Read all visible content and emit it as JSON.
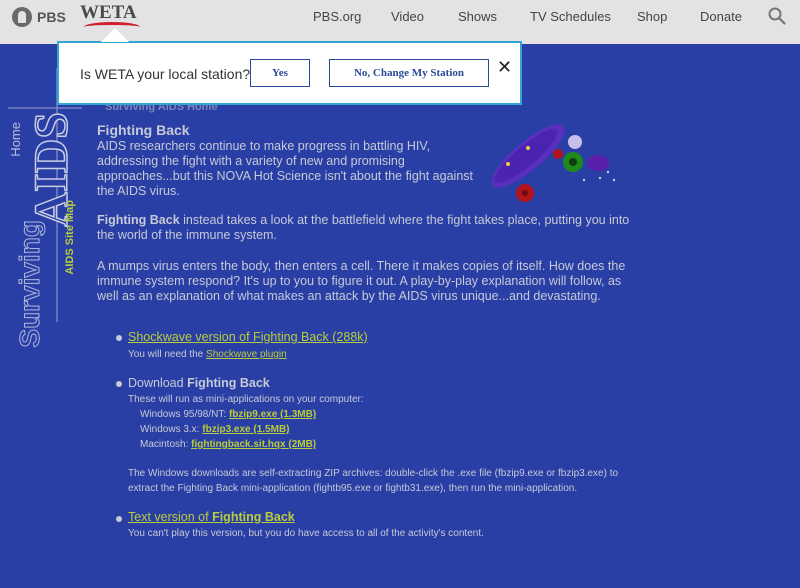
{
  "pbs_bar": {
    "pbs_logo": "PBS",
    "weta_logo": "WETA",
    "nav": [
      "PBS.org",
      "Video",
      "Shows",
      "TV Schedules",
      "Shop",
      "Donate"
    ]
  },
  "popup": {
    "question": "Is WETA your local station?",
    "yes": "Yes",
    "no": "No, Change My Station",
    "close": "✕"
  },
  "side": {
    "home": "Home",
    "aids": "AIDS",
    "surviving": "Surviving",
    "sitemap": "AIDS Site Map"
  },
  "article": {
    "hidden_heading": "Surviving AIDS Home",
    "title": "Fighting Back",
    "p1": "AIDS researchers continue to make progress in battling HIV, addressing the fight with a variety of new and promising approaches...but this NOVA Hot Science isn't about the fight against the AIDS virus.",
    "p2_bold": "Fighting Back",
    "p2_rest": " instead takes a look at the battlefield where the fight takes place, putting you into the world of the immune system.",
    "p3": "A mumps virus enters the body, then enters a cell. There it makes copies of itself. How does the immune system respond? It's up to you to figure it out. A play-by-play explanation will follow, as well as an explanation of what makes an attack by the AIDS virus unique...and devastating."
  },
  "options": {
    "shockwave_link": "Shockwave version of Fighting Back (288k)",
    "shockwave_note_prefix": "You will need the ",
    "shockwave_plugin": "Shockwave plugin",
    "download_prefix": "Download ",
    "download_bold": "Fighting Back",
    "download_note": "These will run as mini-applications on your computer:",
    "win95_label": "Windows 95/98/NT: ",
    "win95_link": "fbzip9.exe (1.3MB)",
    "win3_label": "Windows 3.x: ",
    "win3_link": "fbzip3.exe (1.5MB)",
    "mac_label": "Macintosh: ",
    "mac_link": "fightingback.sit.hqx (2MB)",
    "zip_note_1": "The Windows downloads are self-extracting ZIP archives: double-click the .exe file (fbzip9.exe or fbzip3.exe) to",
    "zip_note_2": "extract the Fighting Back mini-application (fightb95.exe or fightb31.exe), then run the mini-application.",
    "text_link_prefix": "Text version of ",
    "text_link_bold": "Fighting Back",
    "text_note": "You can't play this version, but you do have access to all of the activity's content."
  },
  "colors": {
    "background": "#2a3fa6",
    "link": "#b9cc3c",
    "popup_border": "#33a6d8"
  }
}
